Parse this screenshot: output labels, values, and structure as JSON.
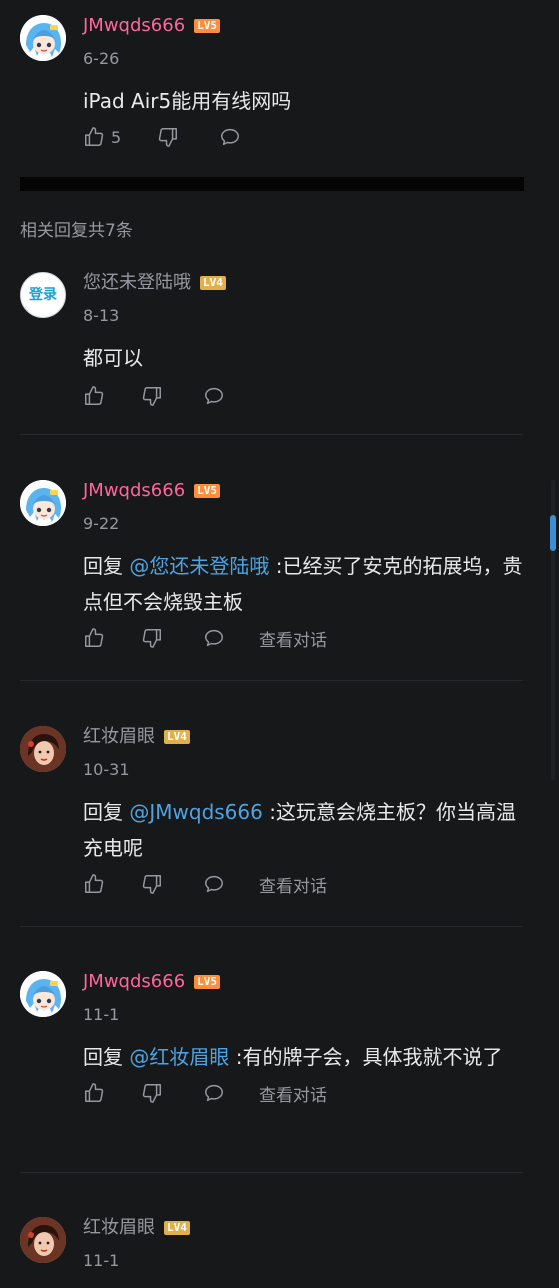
{
  "main_comment": {
    "user": "JMwqds666",
    "level": "LV5",
    "date": "6-26",
    "text": "iPad Air5能用有线网吗",
    "like_count": "5"
  },
  "section_title": "相关回复共7条",
  "replies": [
    {
      "user": "您还未登陆哦",
      "level": "LV4",
      "date": "8-13",
      "text": "都可以"
    },
    {
      "user": "JMwqds666",
      "level": "LV5",
      "date": "9-22",
      "reply_prefix": "回复 ",
      "at": "@您还未登陆哦",
      "text": " :已经买了安克的拓展坞，贵点但不会烧毁主板",
      "view": "查看对话"
    },
    {
      "user": "红妆眉眼",
      "level": "LV4",
      "date": "10-31",
      "reply_prefix": "回复 ",
      "at": "@JMwqds666",
      "text": " :这玩意会烧主板？你当高温充电呢",
      "view": "查看对话"
    },
    {
      "user": "JMwqds666",
      "level": "LV5",
      "date": "11-1",
      "reply_prefix": "回复 ",
      "at": "@红妆眉眼",
      "text": " :有的牌子会，具体我就不说了",
      "view": "查看对话"
    },
    {
      "user": "红妆眉眼",
      "level": "LV4",
      "date": "11-1"
    }
  ],
  "avatars": {
    "guest_text": "登录"
  },
  "colors": {
    "username_pink": "#ff6699",
    "link_blue": "#4fa3e0",
    "bg": "#17181a",
    "lv5": "#ff8d3a",
    "lv4": "#e2b04b"
  },
  "icons": {
    "like": "thumb-up-icon",
    "dislike": "thumb-down-icon",
    "reply": "chat-bubble-icon"
  }
}
